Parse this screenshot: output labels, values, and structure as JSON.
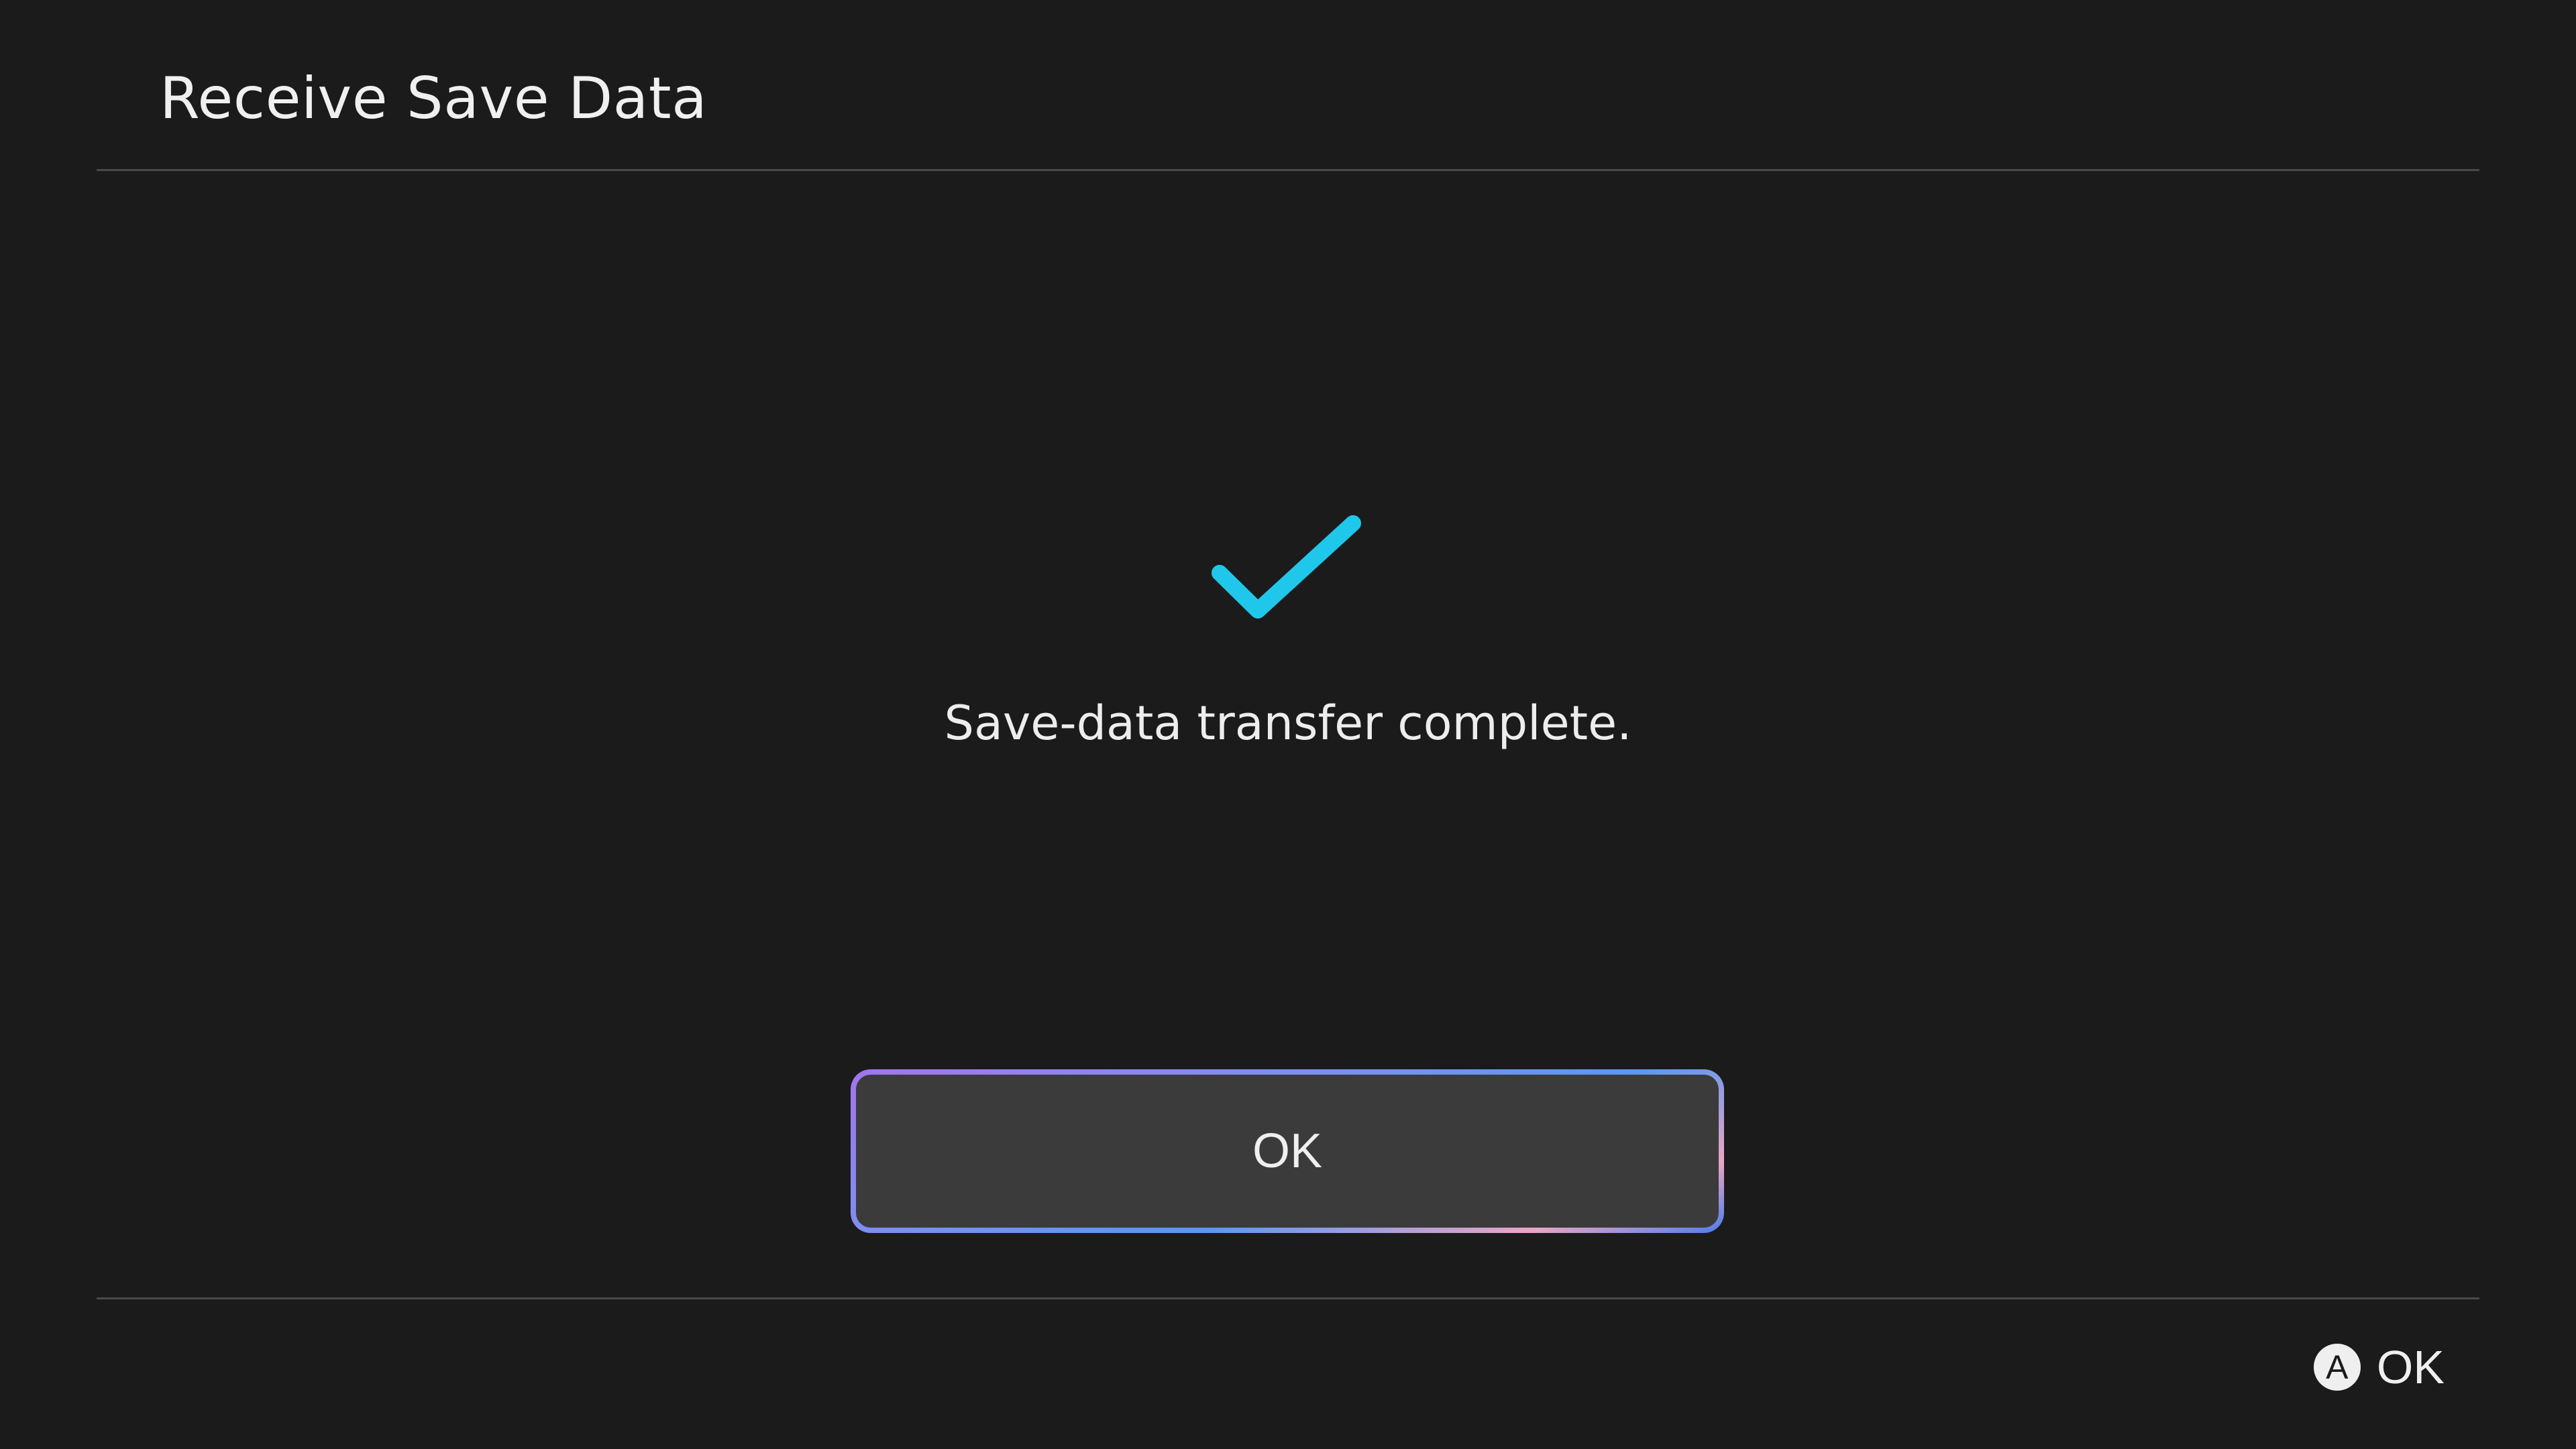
{
  "header": {
    "title": "Receive Save Data"
  },
  "status": {
    "icon": "checkmark-icon",
    "message": "Save-data transfer complete."
  },
  "dialog": {
    "ok_label": "OK"
  },
  "footer": {
    "button_glyph": "A",
    "button_icon": "a-button-icon",
    "action_label": "OK"
  },
  "colors": {
    "background": "#1b1b1b",
    "accent_check": "#1fc8ea",
    "button_fill": "#3b3b3b",
    "focus_gradient": [
      "#a275ee",
      "#5a96f4",
      "#e9a6c4",
      "#4c7cec"
    ]
  }
}
